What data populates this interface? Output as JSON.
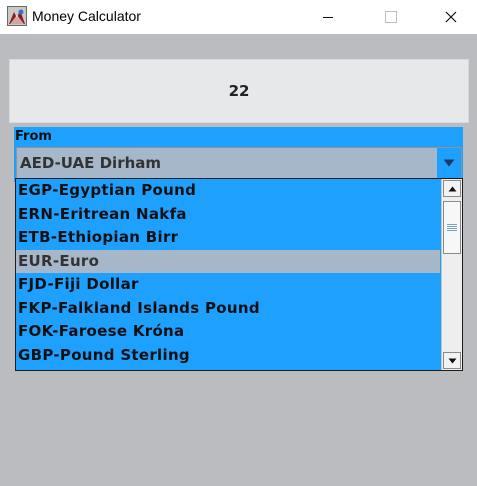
{
  "window": {
    "title": "Money Calculator",
    "icon": "app-icon",
    "controls": [
      "minimize-icon",
      "maximize-icon",
      "close-icon"
    ]
  },
  "display": {
    "value": "22"
  },
  "from": {
    "label": "From",
    "selected": "AED-UAE Dirham"
  },
  "list": {
    "items": [
      {
        "label": "EGP-Egyptian Pound"
      },
      {
        "label": "ERN-Eritrean Nakfa"
      },
      {
        "label": "ETB-Ethiopian Birr"
      },
      {
        "label": "EUR-Euro"
      },
      {
        "label": "FJD-Fiji Dollar"
      },
      {
        "label": "FKP-Falkland Islands Pound"
      },
      {
        "label": "FOK-Faroese Króna"
      },
      {
        "label": "GBP-Pound Sterling"
      }
    ],
    "highlighted_index": 3
  },
  "colors": {
    "panel_blue": "#1ea0ff",
    "selection": "#a5b7c9",
    "display_bg": "#e6e8ea",
    "window_bg": "#bbbcbf"
  }
}
